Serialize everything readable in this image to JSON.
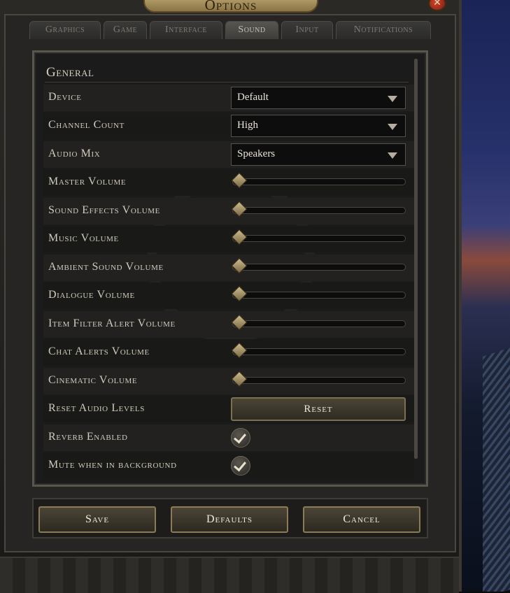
{
  "window": {
    "title": "Options",
    "close_icon": "close-icon"
  },
  "tabs": [
    {
      "label": "Graphics",
      "active": false
    },
    {
      "label": "Game",
      "active": false
    },
    {
      "label": "Interface",
      "active": false
    },
    {
      "label": "Sound",
      "active": true
    },
    {
      "label": "Input",
      "active": false
    },
    {
      "label": "Notifications",
      "active": false
    }
  ],
  "general": {
    "section_title": "General",
    "device": {
      "label": "Device",
      "value": "Default"
    },
    "channel_count": {
      "label": "Channel Count",
      "value": "High"
    },
    "audio_mix": {
      "label": "Audio Mix",
      "value": "Speakers"
    },
    "sliders": [
      {
        "label": "Master Volume",
        "level": 0.0
      },
      {
        "label": "Sound Effects Volume",
        "level": 0.0
      },
      {
        "label": "Music Volume",
        "level": 0.0
      },
      {
        "label": "Ambient Sound Volume",
        "level": 0.0
      },
      {
        "label": "Dialogue Volume",
        "level": 0.0
      },
      {
        "label": "Item Filter Alert Volume",
        "level": 0.0
      },
      {
        "label": "Chat Alerts Volume",
        "level": 0.0
      },
      {
        "label": "Cinematic Volume",
        "level": 0.0
      }
    ],
    "reset_audio": {
      "label": "Reset Audio Levels",
      "button": "Reset"
    },
    "reverb": {
      "label": "Reverb Enabled",
      "checked": true
    },
    "mute_background": {
      "label": "Mute when in background",
      "checked": true
    }
  },
  "footer": {
    "save": "Save",
    "defaults": "Defaults",
    "cancel": "Cancel"
  },
  "colors": {
    "accent_gold": "#cdbb8c",
    "text": "#d2ccbd",
    "panel": "#1b1b1b"
  }
}
